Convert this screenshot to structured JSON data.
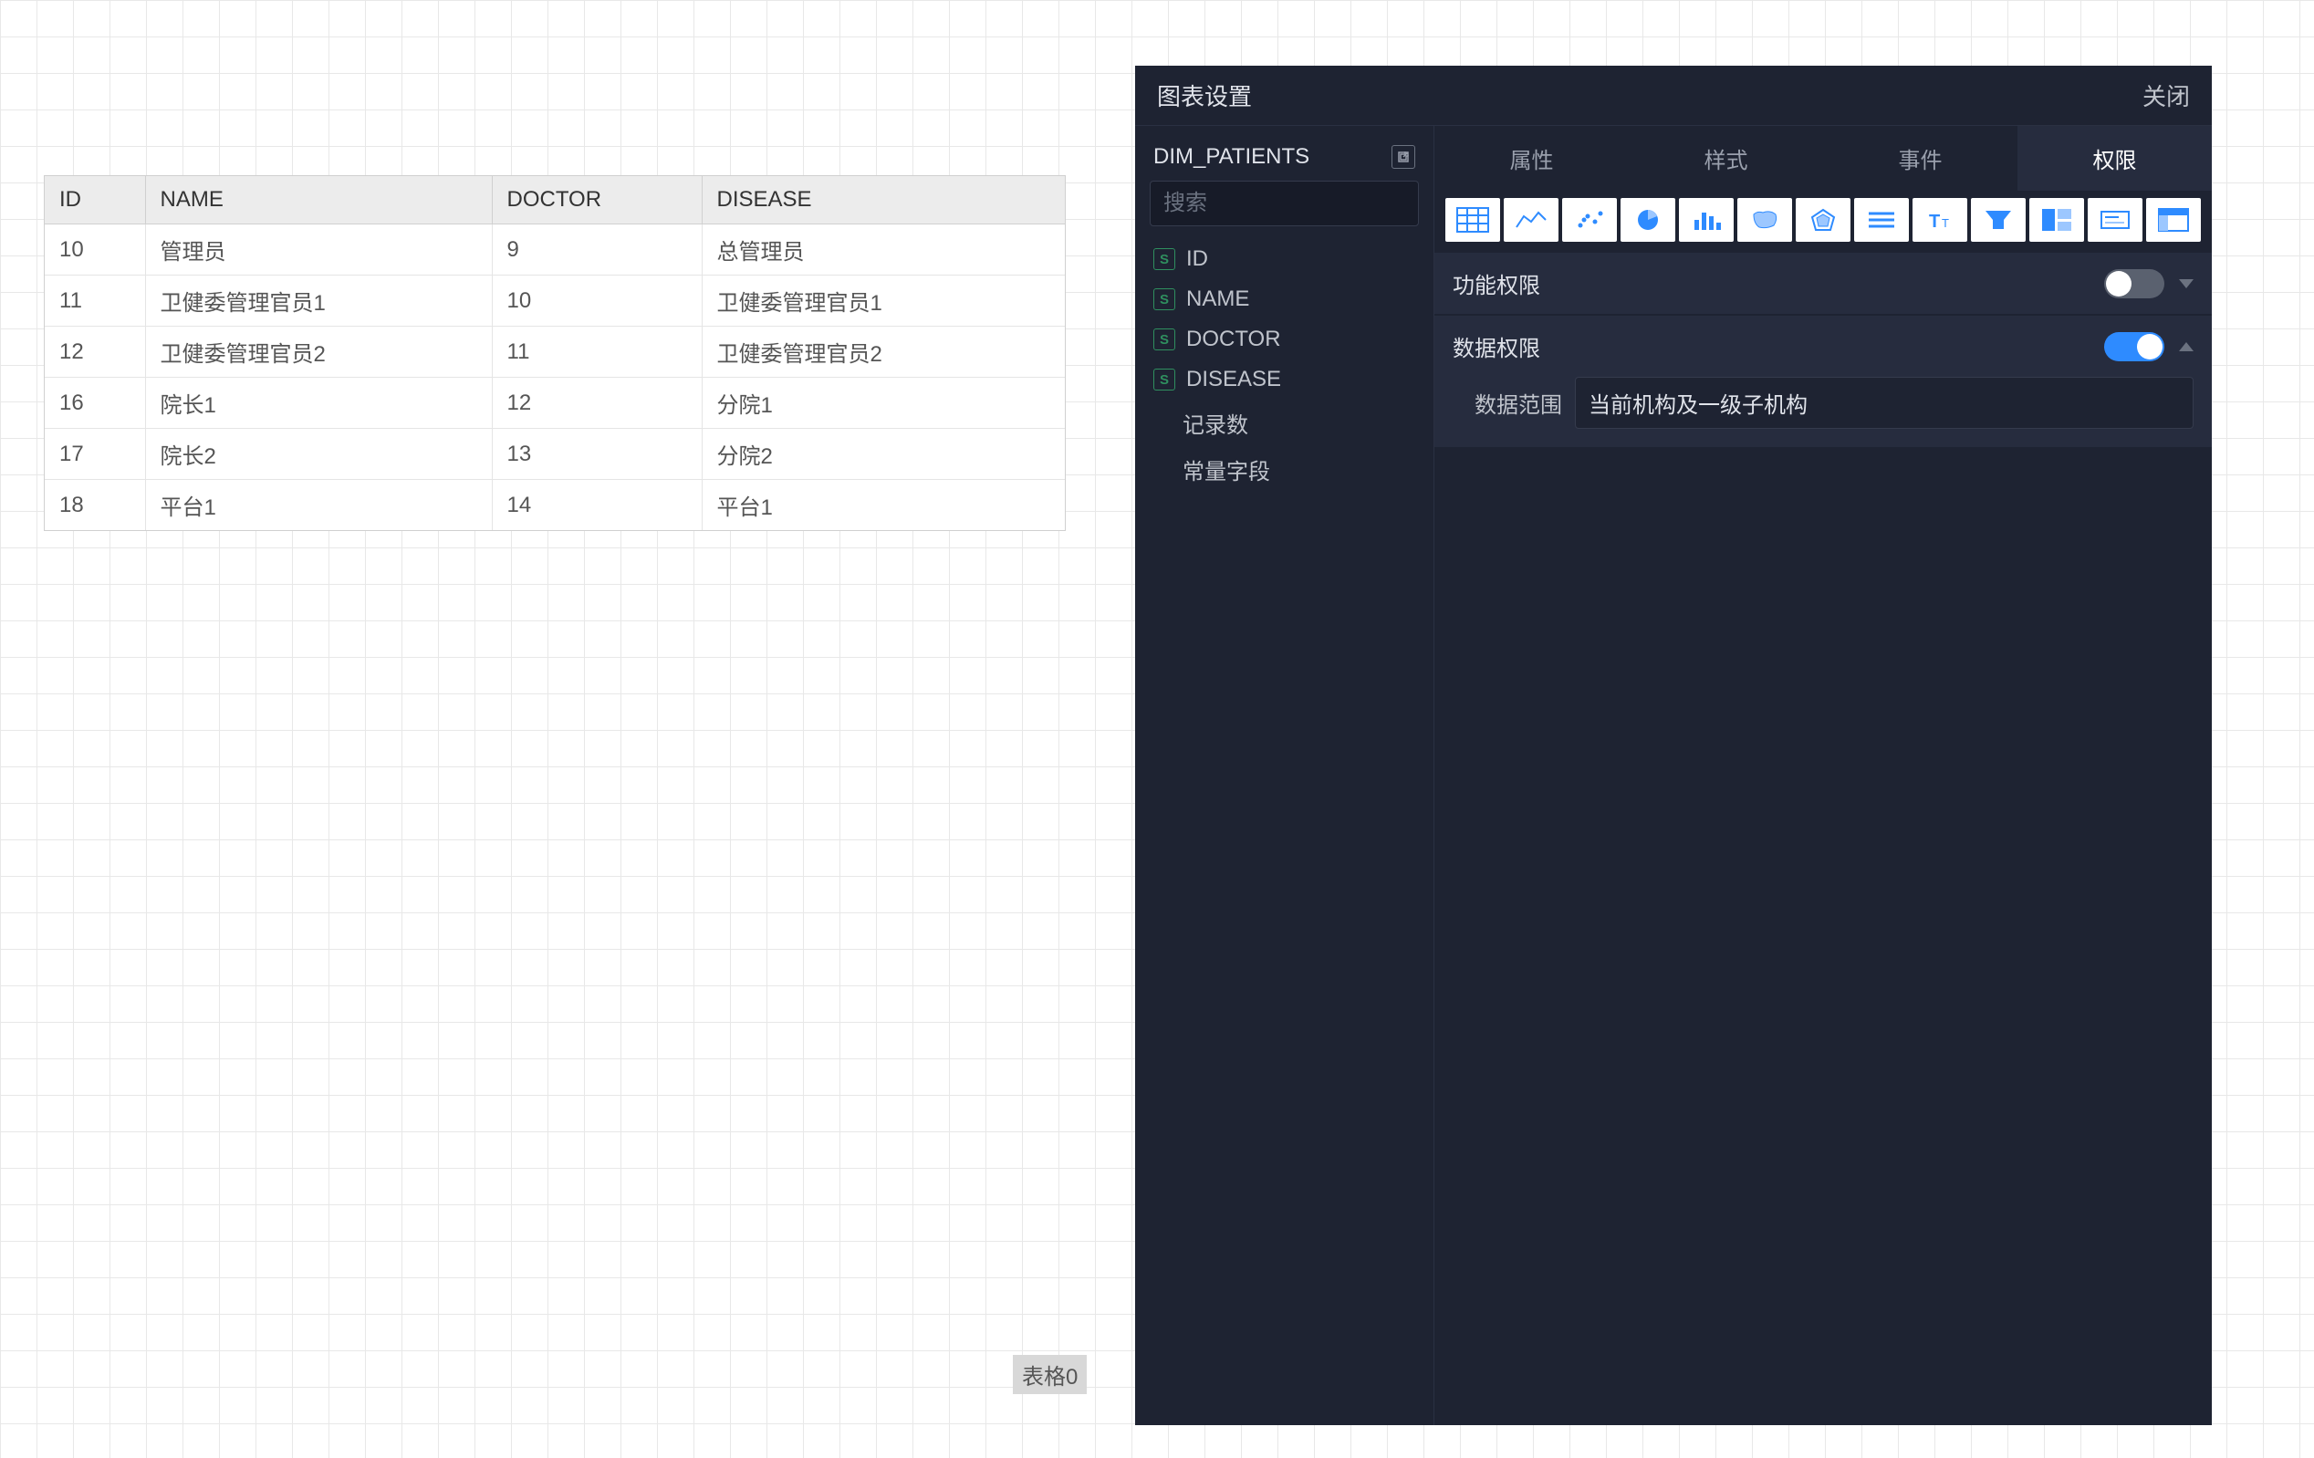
{
  "canvas": {
    "widget_label": "表格0",
    "table": {
      "headers": [
        "ID",
        "NAME",
        "DOCTOR",
        "DISEASE"
      ],
      "rows": [
        {
          "id": "10",
          "name": "管理员",
          "doctor": "9",
          "disease": "总管理员"
        },
        {
          "id": "11",
          "name": "卫健委管理官员1",
          "doctor": "10",
          "disease": "卫健委管理官员1"
        },
        {
          "id": "12",
          "name": "卫健委管理官员2",
          "doctor": "11",
          "disease": "卫健委管理官员2"
        },
        {
          "id": "16",
          "name": "院长1",
          "doctor": "12",
          "disease": "分院1"
        },
        {
          "id": "17",
          "name": "院长2",
          "doctor": "13",
          "disease": "分院2"
        },
        {
          "id": "18",
          "name": "平台1",
          "doctor": "14",
          "disease": "平台1"
        }
      ]
    }
  },
  "panel": {
    "title": "图表设置",
    "close": "关闭",
    "datasource": {
      "name": "DIM_PATIENTS",
      "search_placeholder": "搜索",
      "fields": [
        "ID",
        "NAME",
        "DOCTOR",
        "DISEASE"
      ],
      "extras": [
        "记录数",
        "常量字段"
      ]
    },
    "tabs": [
      "属性",
      "样式",
      "事件",
      "权限"
    ],
    "active_tab": 3,
    "chart_icons": [
      "table-icon",
      "line-chart-icon",
      "scatter-chart-icon",
      "pie-chart-icon",
      "bar-chart-icon",
      "china-map-icon",
      "radar-chart-icon",
      "list-chart-icon",
      "text-chart-icon",
      "funnel-chart-icon",
      "dashboard-panel-icon",
      "kpi-chart-icon",
      "pivot-table-icon"
    ],
    "permissions": {
      "func_label": "功能权限",
      "func_on": false,
      "data_label": "数据权限",
      "data_on": true,
      "scope_label": "数据范围",
      "scope_value": "当前机构及一级子机构"
    }
  }
}
